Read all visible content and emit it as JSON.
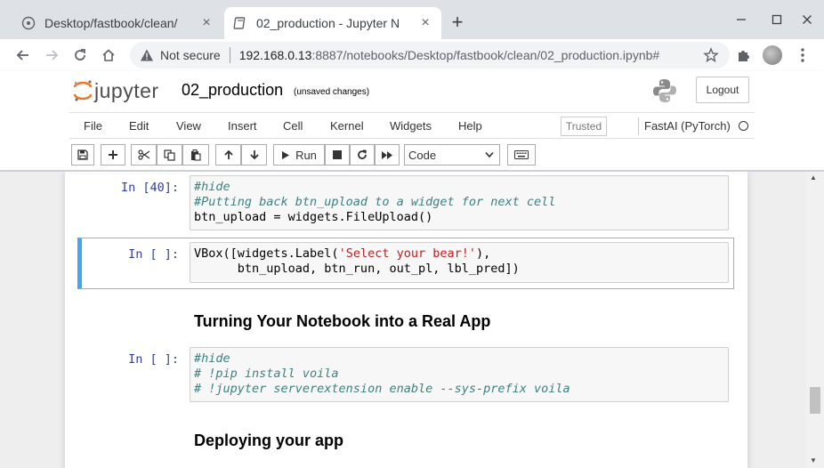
{
  "browser": {
    "tabs": [
      {
        "title": "Desktop/fastbook/clean/",
        "active": false
      },
      {
        "title": "02_production - Jupyter N",
        "active": true
      }
    ],
    "new_tab_label": "+",
    "url": {
      "security_label": "Not secure",
      "host": "192.168.0.13",
      "path": ":8887/notebooks/Desktop/fastbook/clean/02_production.ipynb#"
    }
  },
  "jupyter": {
    "logo_text": "jupyter",
    "notebook_name": "02_production",
    "autosave_status": "(unsaved changes)",
    "logout_label": "Logout",
    "menu": [
      "File",
      "Edit",
      "View",
      "Insert",
      "Cell",
      "Kernel",
      "Widgets",
      "Help"
    ],
    "trusted_label": "Trusted",
    "kernel_name": "FastAI (PyTorch)",
    "toolbar": {
      "run_label": "Run",
      "cell_type": "Code"
    }
  },
  "cells": [
    {
      "type": "code",
      "prompt": "In [40]:",
      "lines": [
        {
          "comment": "#hide"
        },
        {
          "comment": "#Putting back btn_upload to a widget for next cell"
        },
        {
          "code": "btn_upload = widgets.FileUpload()"
        }
      ]
    },
    {
      "type": "code",
      "prompt": "In [ ]:",
      "selected": true,
      "line1_pre": "VBox([widgets.Label(",
      "line1_str": "'Select your bear!'",
      "line1_post": "),",
      "line2": "      btn_upload, btn_run, out_pl, lbl_pred])"
    },
    {
      "type": "markdown",
      "text": "Turning Your Notebook into a Real App"
    },
    {
      "type": "code",
      "prompt": "In [ ]:",
      "lines": [
        {
          "comment": "#hide"
        },
        {
          "comment": "# !pip install voila"
        },
        {
          "comment": "# !jupyter serverextension enable --sys-prefix voila"
        }
      ]
    },
    {
      "type": "markdown",
      "text": "Deploying your app"
    }
  ],
  "colors": {
    "accent_selected": "#42a5f5",
    "prompt": "#303f9f",
    "comment": "#408080",
    "string": "#ba2121"
  }
}
